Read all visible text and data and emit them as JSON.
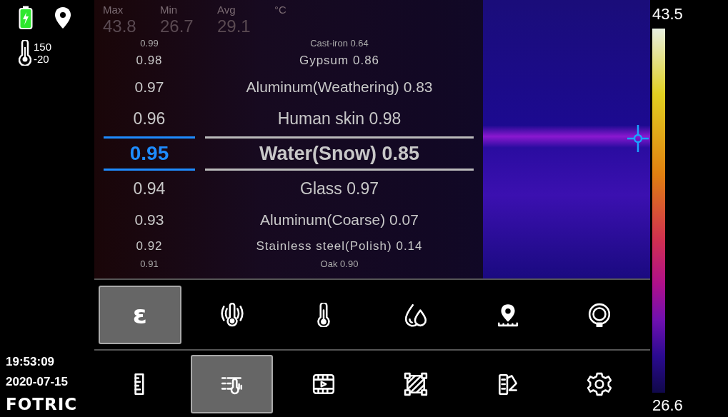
{
  "status": {
    "range_high": "150",
    "range_low": "-20"
  },
  "stats": {
    "labels": [
      "Max",
      "Min",
      "Avg",
      "°C"
    ],
    "values": [
      "43.8",
      "26.7",
      "29.1"
    ]
  },
  "picker": {
    "rows": [
      {
        "value": "0.99",
        "material": "Cast-iron 0.64",
        "selected": false
      },
      {
        "value": "0.98",
        "material": "Gypsum 0.86",
        "selected": false
      },
      {
        "value": "0.97",
        "material": "Aluminum(Weathering) 0.83",
        "selected": false
      },
      {
        "value": "0.96",
        "material": "Human skin 0.98",
        "selected": false
      },
      {
        "value": "0.95",
        "material": "Water(Snow) 0.85",
        "selected": true
      },
      {
        "value": "0.94",
        "material": "Glass 0.97",
        "selected": false
      },
      {
        "value": "0.93",
        "material": "Aluminum(Coarse) 0.07",
        "selected": false
      },
      {
        "value": "0.92",
        "material": "Stainless steel(Polish) 0.14",
        "selected": false
      },
      {
        "value": "0.91",
        "material": "Oak 0.90",
        "selected": false
      }
    ]
  },
  "scale": {
    "max": "43.5",
    "min": "26.6"
  },
  "toolbar": {
    "rows": [
      [
        {
          "kind": "epsilon",
          "label": "ε",
          "selected": true
        },
        {
          "kind": "thermo-signal",
          "selected": false
        },
        {
          "kind": "thermometer",
          "selected": false
        },
        {
          "kind": "droplets",
          "selected": false
        },
        {
          "kind": "pin-ruler",
          "selected": false
        },
        {
          "kind": "ring",
          "selected": false
        }
      ],
      [
        {
          "kind": "ruler",
          "selected": false
        },
        {
          "kind": "list-thermo",
          "selected": true
        },
        {
          "kind": "film",
          "selected": false
        },
        {
          "kind": "hatch-area",
          "selected": false
        },
        {
          "kind": "palette",
          "selected": false
        },
        {
          "kind": "gear",
          "selected": false
        }
      ]
    ]
  },
  "footer": {
    "time": "19:53:09",
    "date": "2020-07-15",
    "logo": "FOTRIC"
  }
}
